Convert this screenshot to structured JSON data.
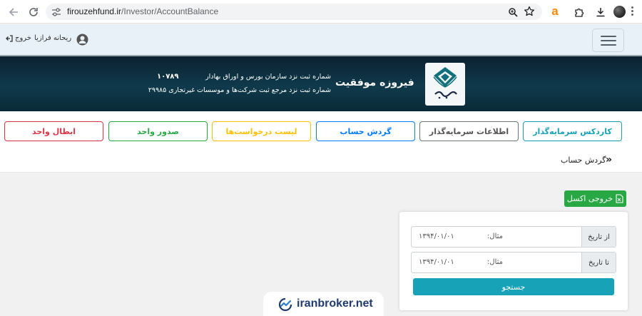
{
  "browser": {
    "url_host": "firouzehfund.ir",
    "url_path": "/Investor/AccountBalance",
    "extension_letter": "a"
  },
  "header": {
    "user_name": "ریحانه فرازیا",
    "logout_label": "خروج"
  },
  "banner": {
    "brand": "فیروزه موفقیت",
    "reg_line_1": "شماره ثبت نزد سازمان بورس و اوراق بهادار",
    "reg_number_1": "۱۰۷۸۹",
    "reg_line_2": "شماره ثبت نزد مرجع ثبت شرکت‌ها و موسسات غیرتجاری ۲۹۹۸۵"
  },
  "menu": [
    {
      "label": "کاردکس سرمایه‌گذار",
      "color": "#17a2b8"
    },
    {
      "label": "اطلاعات سرمایه‌گذار",
      "color": "#6c757d"
    },
    {
      "label": "گردش حساب",
      "color": "#007bff"
    },
    {
      "label": "لیست درخواست‌ها",
      "color": "#ffc107"
    },
    {
      "label": "صدور واحد",
      "color": "#28a745"
    },
    {
      "label": "ابطال واحد",
      "color": "#dc3545"
    }
  ],
  "breadcrumb": {
    "arrow": "»",
    "label": "گردش حساب"
  },
  "content": {
    "excel_button": "خروجی اکسل",
    "from_label": "از تاریخ",
    "from_placeholder": "مثال:",
    "from_value": "۱۳۹۴/۰۱/۰۱",
    "to_label": "تا تاریخ",
    "to_placeholder": "مثال:",
    "to_value": "۱۳۹۴/۰۱/۰۱",
    "search_button": "جستجو"
  },
  "watermark": {
    "text": "iranbroker.net"
  },
  "colors": {
    "banner_dark": "#0c2130",
    "header_bg": "#e9f1f8",
    "excel_green": "#28a745",
    "search_teal": "#17a2b8"
  },
  "icons": [
    "back-arrow-icon",
    "reload-icon",
    "tune-icon",
    "zoom-icon",
    "star-icon",
    "puzzle-icon",
    "download-icon",
    "hamburger-icon",
    "user-icon",
    "logout-icon",
    "excel-icon",
    "iranbroker-logo-icon"
  ]
}
